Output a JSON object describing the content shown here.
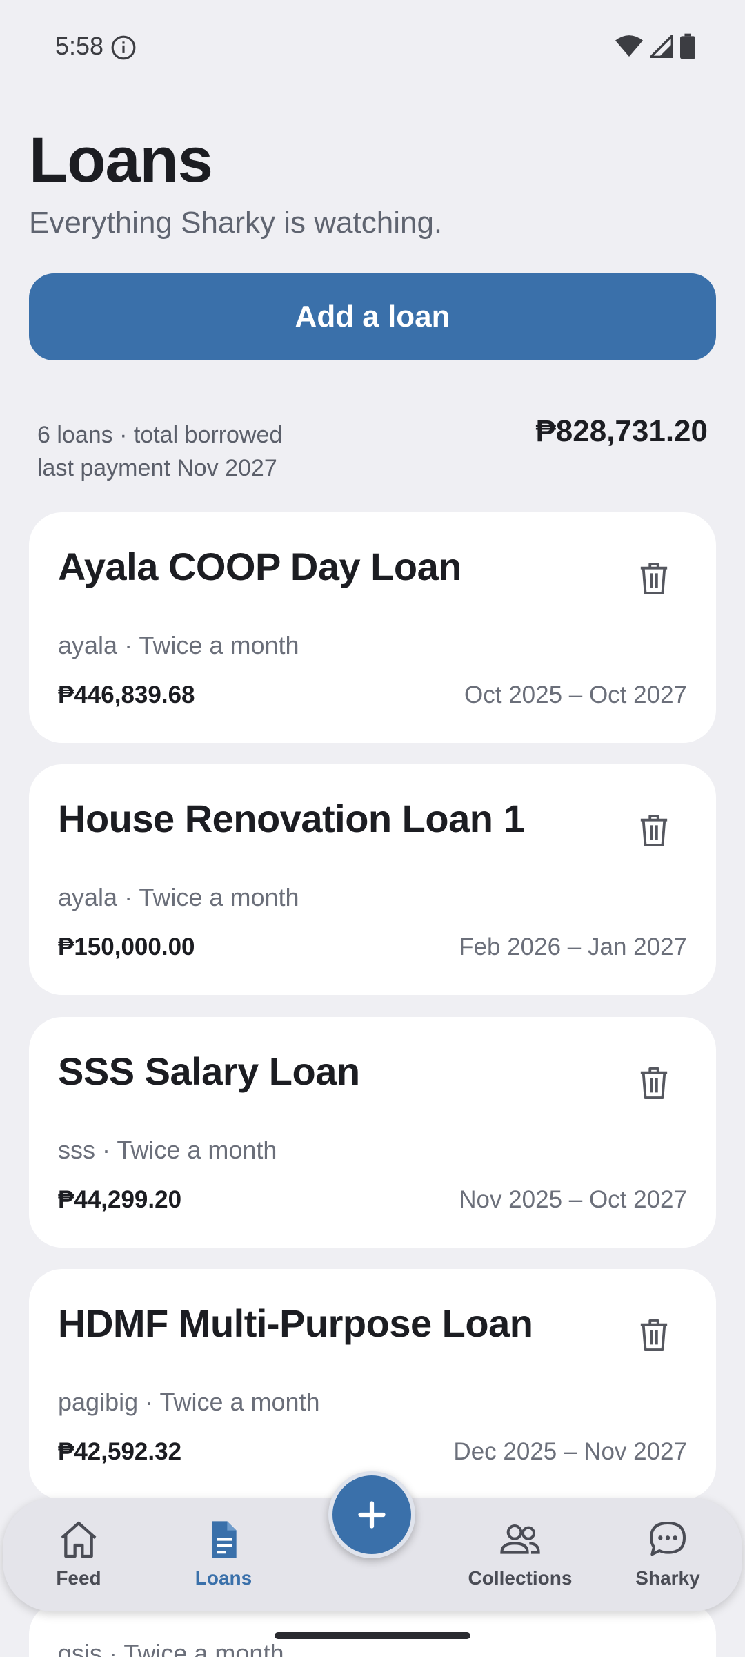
{
  "status_bar": {
    "time": "5:58"
  },
  "header": {
    "title": "Loans",
    "subtitle": "Everything Sharky is watching."
  },
  "add_button_label": "Add a loan",
  "summary": {
    "count_line": "6 loans · total borrowed",
    "last_payment_line": "last payment Nov 2027",
    "total": "₱828,731.20"
  },
  "loans": [
    {
      "name": "Ayala COOP Day Loan",
      "meta": "ayala · Twice a month",
      "amount": "₱446,839.68",
      "dates": "Oct 2025 – Oct 2027"
    },
    {
      "name": "House Renovation Loan 1",
      "meta": "ayala · Twice a month",
      "amount": "₱150,000.00",
      "dates": "Feb 2026 – Jan 2027"
    },
    {
      "name": "SSS Salary Loan",
      "meta": "sss · Twice a month",
      "amount": "₱44,299.20",
      "dates": "Nov 2025 – Oct 2027"
    },
    {
      "name": "HDMF Multi-Purpose Loan",
      "meta": "pagibig · Twice a month",
      "amount": "₱42,592.32",
      "dates": "Dec 2025 – Nov 2027"
    }
  ],
  "partial_loan": {
    "meta": "gsis · Twice a month"
  },
  "nav": {
    "feed": "Feed",
    "loans": "Loans",
    "collections": "Collections",
    "sharky": "Sharky"
  },
  "colors": {
    "accent": "#3a70aa",
    "background": "#efeff3",
    "card": "#ffffff"
  },
  "icons": {
    "delete": "trash-icon",
    "fab": "plus-icon",
    "feed": "home-icon",
    "loans": "document-icon",
    "collections": "people-icon",
    "sharky": "chat-bubble-icon"
  }
}
